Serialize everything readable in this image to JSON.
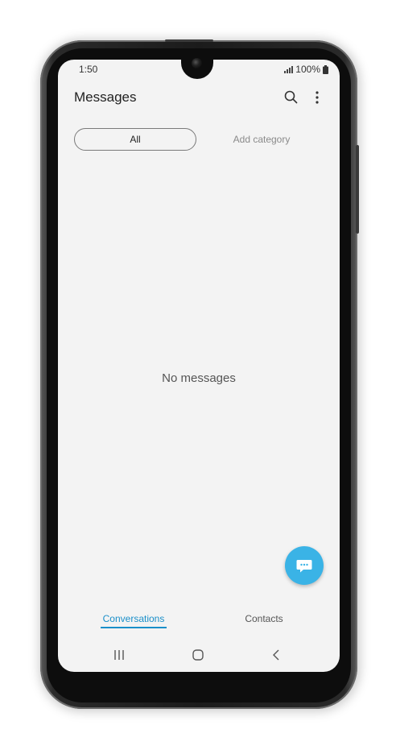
{
  "status_bar": {
    "time": "1:50",
    "battery": "100%",
    "signal_icon": "signal-icon",
    "battery_icon": "battery-icon"
  },
  "app_bar": {
    "title": "Messages",
    "search_icon": "search-icon",
    "more_icon": "more-vertical-icon"
  },
  "categories": {
    "all_label": "All",
    "add_label": "Add category"
  },
  "empty_state": {
    "text": "No messages"
  },
  "fab": {
    "icon": "chat-bubble-icon",
    "color": "#3ab3e6"
  },
  "bottom_tabs": {
    "conversations_label": "Conversations",
    "contacts_label": "Contacts",
    "active_color": "#1a8fc9"
  },
  "nav_bar": {
    "recent_icon": "recent-apps-icon",
    "home_icon": "home-icon",
    "back_icon": "back-icon"
  }
}
